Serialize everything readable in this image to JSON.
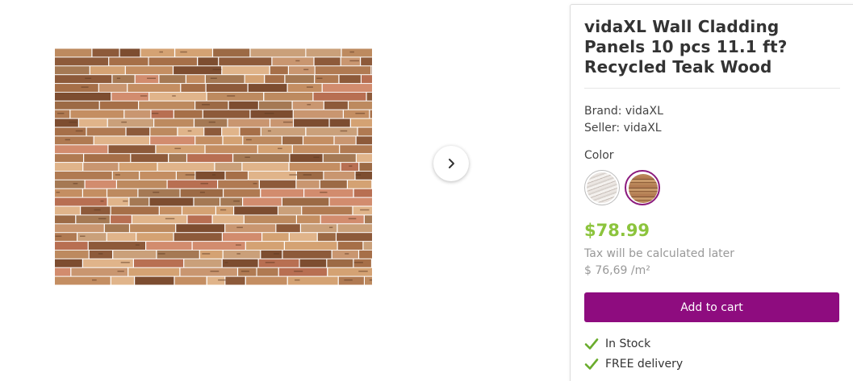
{
  "gallery": {
    "image_alt": "Recycled teak wood wall cladding panel",
    "next_icon": "chevron-right-icon"
  },
  "product": {
    "title": "vidaXL Wall Cladding Panels 10 pcs 11.1 ft? Recycled Teak Wood",
    "brand_line": "Brand: vidaXL",
    "seller_line": "Seller: vidaXL",
    "color_label": "Color",
    "colors": [
      {
        "name": "white-washed",
        "selected": false
      },
      {
        "name": "teak",
        "selected": true
      }
    ],
    "price": "$78.99",
    "tax_note": "Tax will be calculated later",
    "unit_price": "$ 76,69 /m²",
    "cart_button": "Add to cart",
    "features": [
      {
        "icon": "checkmark-icon",
        "label": "In Stock"
      },
      {
        "icon": "checkmark-icon",
        "label": "FREE delivery"
      }
    ]
  },
  "colors": {
    "brand_purple": "#8e0c7f",
    "price_green": "#8cc43d",
    "check_green": "#6aac2d"
  }
}
